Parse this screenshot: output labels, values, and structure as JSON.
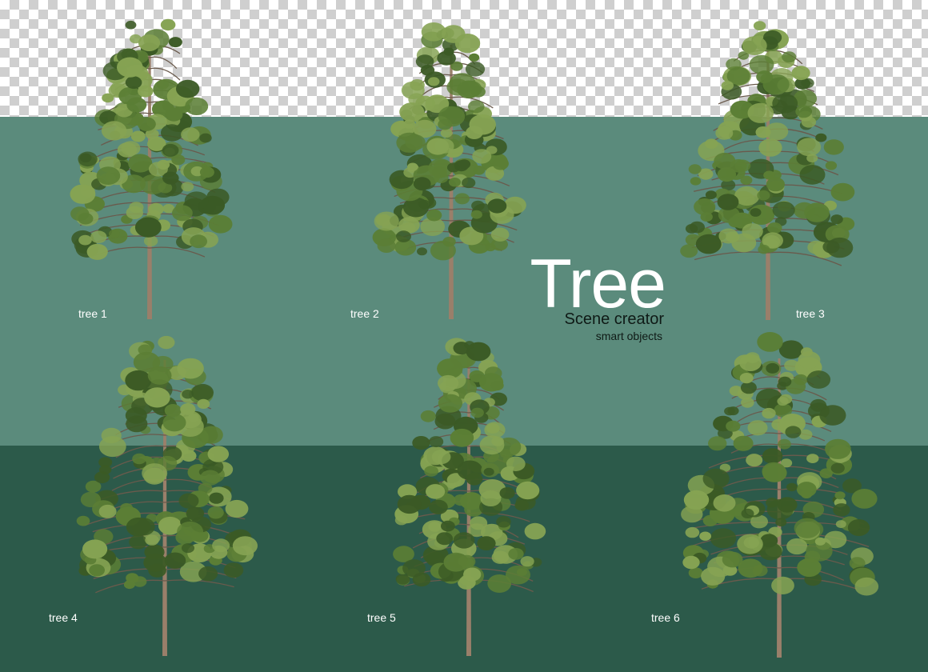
{
  "colors": {
    "band_light": "#5b8b7c",
    "band_dark": "#2c5a4a",
    "foliage_dark": "#3b5a25",
    "foliage_mid": "#5b7e35",
    "foliage_light": "#86a353",
    "trunk": "#9a7f6a"
  },
  "title": {
    "main": "Tree",
    "subtitle": "Scene creator",
    "caption": "smart objects"
  },
  "trees": [
    {
      "label": "tree 1"
    },
    {
      "label": "tree 2"
    },
    {
      "label": "tree 3"
    },
    {
      "label": "tree 4"
    },
    {
      "label": "tree 5"
    },
    {
      "label": "tree 6"
    }
  ]
}
